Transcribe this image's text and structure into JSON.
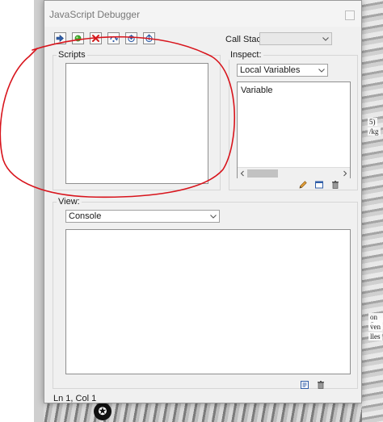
{
  "window": {
    "title": "JavaScript Debugger"
  },
  "toolbar": {
    "icons": [
      "go-icon",
      "record-icon",
      "quit-icon",
      "step-over-icon",
      "step-into-icon",
      "step-out-icon"
    ]
  },
  "call_stack": {
    "label": "Call Stack:",
    "value": ""
  },
  "scripts": {
    "label": "Scripts"
  },
  "inspect": {
    "label": "Inspect:",
    "selected": "Local Variables",
    "column_header": "Variable"
  },
  "view": {
    "label": "View:",
    "selected": "Console"
  },
  "status": {
    "position": "Ln 1, Col 1"
  },
  "background": {
    "fragments": [
      "5)",
      "/kg",
      "on S",
      "ven",
      "lles"
    ]
  },
  "colors": {
    "annotation": "#d8141c",
    "dialog_bg": "#f0f0f0",
    "go": "#2f5da8",
    "record": "#3fae2a",
    "quit": "#d21d1d",
    "step": "#2f5da8"
  }
}
